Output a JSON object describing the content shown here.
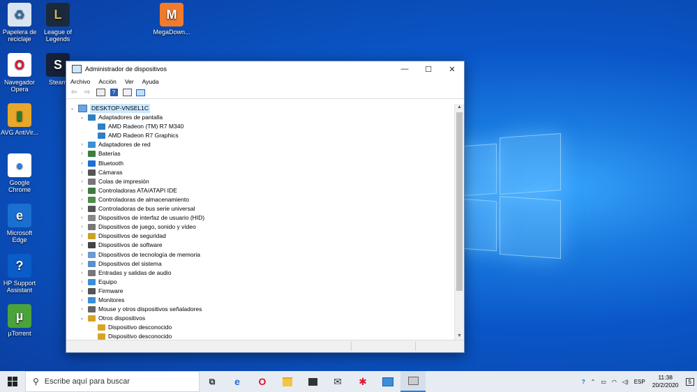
{
  "desktop": {
    "icons": [
      {
        "label": "Papelera de reciclaje",
        "glyph": "♻",
        "bg": "#d9e6f2",
        "fg": "#2d6aa5"
      },
      {
        "label": "League of Legends",
        "glyph": "L",
        "bg": "#1b2a3a",
        "fg": "#d4b25e"
      },
      {
        "label": "MegaDown...",
        "glyph": "M",
        "bg": "#f07b2c",
        "fg": "#ffffff"
      },
      {
        "label": "Navegador Opera",
        "glyph": "O",
        "bg": "#ffffff",
        "fg": "#e0112d"
      },
      {
        "label": "Steam",
        "glyph": "S",
        "bg": "#16213a",
        "fg": "#ffffff"
      },
      {
        "label": "AVG AntiVir...",
        "glyph": "▮",
        "bg": "#e7a72b",
        "fg": "#2c7a2c"
      },
      {
        "label": "Google Chrome",
        "glyph": "●",
        "bg": "#ffffff",
        "fg": "#2b7de9"
      },
      {
        "label": "Microsoft Edge",
        "glyph": "e",
        "bg": "#1a6fd1",
        "fg": "#ffffff"
      },
      {
        "label": "HP Support Assistant",
        "glyph": "?",
        "bg": "#0a5cc8",
        "fg": "#ffffff"
      },
      {
        "label": "µTorrent",
        "glyph": "µ",
        "bg": "#4ba33b",
        "fg": "#ffffff"
      }
    ]
  },
  "window": {
    "title": "Administrador de dispositivos",
    "controls": {
      "minimize": "—",
      "maximize": "☐",
      "close": "✕"
    },
    "menu": [
      "Archivo",
      "Acción",
      "Ver",
      "Ayuda"
    ],
    "toolbar_icons": [
      "back-icon",
      "forward-icon",
      "properties-icon",
      "help-icon",
      "view-icon",
      "monitor-icon"
    ],
    "tree": {
      "root": "DESKTOP-VNSEL1C",
      "items": [
        {
          "label": "Adaptadores de pantalla",
          "level": 1,
          "expanded": true,
          "color": "#2f7fc4"
        },
        {
          "label": "AMD Radeon (TM) R7 M340",
          "level": 2,
          "color": "#2f7fc4"
        },
        {
          "label": "AMD Radeon R7 Graphics",
          "level": 2,
          "color": "#2f7fc4"
        },
        {
          "label": "Adaptadores de red",
          "level": 1,
          "color": "#3a8fd8"
        },
        {
          "label": "Baterías",
          "level": 1,
          "color": "#3b7f3b"
        },
        {
          "label": "Bluetooth",
          "level": 1,
          "color": "#1e6fd9"
        },
        {
          "label": "Cámaras",
          "level": 1,
          "color": "#555555"
        },
        {
          "label": "Colas de impresión",
          "level": 1,
          "color": "#777777"
        },
        {
          "label": "Controladoras ATA/ATAPI IDE",
          "level": 1,
          "color": "#3f7a3f"
        },
        {
          "label": "Controladoras de almacenamiento",
          "level": 1,
          "color": "#4c8f4c"
        },
        {
          "label": "Controladoras de bus serie universal",
          "level": 1,
          "color": "#555555"
        },
        {
          "label": "Dispositivos de interfaz de usuario (HID)",
          "level": 1,
          "color": "#888888"
        },
        {
          "label": "Dispositivos de juego, sonido y vídeo",
          "level": 1,
          "color": "#777777"
        },
        {
          "label": "Dispositivos de seguridad",
          "level": 1,
          "color": "#c9a227"
        },
        {
          "label": "Dispositivos de software",
          "level": 1,
          "color": "#444444"
        },
        {
          "label": "Dispositivos de tecnología de memoria",
          "level": 1,
          "color": "#6a9bd1"
        },
        {
          "label": "Dispositivos del sistema",
          "level": 1,
          "color": "#5b8fc9"
        },
        {
          "label": "Entradas y salidas de audio",
          "level": 1,
          "color": "#777777"
        },
        {
          "label": "Equipo",
          "level": 1,
          "color": "#3a8fd8"
        },
        {
          "label": "Firmware",
          "level": 1,
          "color": "#555555"
        },
        {
          "label": "Monitores",
          "level": 1,
          "color": "#3a8fd8"
        },
        {
          "label": "Mouse y otros dispositivos señaladores",
          "level": 1,
          "color": "#666666"
        },
        {
          "label": "Otros dispositivos",
          "level": 1,
          "expanded": true,
          "color": "#d8a32a"
        },
        {
          "label": "Dispositivo desconocido",
          "level": 2,
          "color": "#d8a32a"
        },
        {
          "label": "Dispositivo desconocido",
          "level": 2,
          "color": "#d8a32a"
        }
      ]
    }
  },
  "taskbar": {
    "search_placeholder": "Escribe aquí para buscar",
    "apps": [
      "task-view-icon",
      "edge-icon",
      "opera-icon",
      "file-explorer-icon",
      "store-icon",
      "mail-icon",
      "game-icon",
      "remote-desktop-icon",
      "device-manager-icon"
    ],
    "language": "ESP",
    "time": "11:38",
    "date": "20/2/2020",
    "notifications": "5"
  }
}
